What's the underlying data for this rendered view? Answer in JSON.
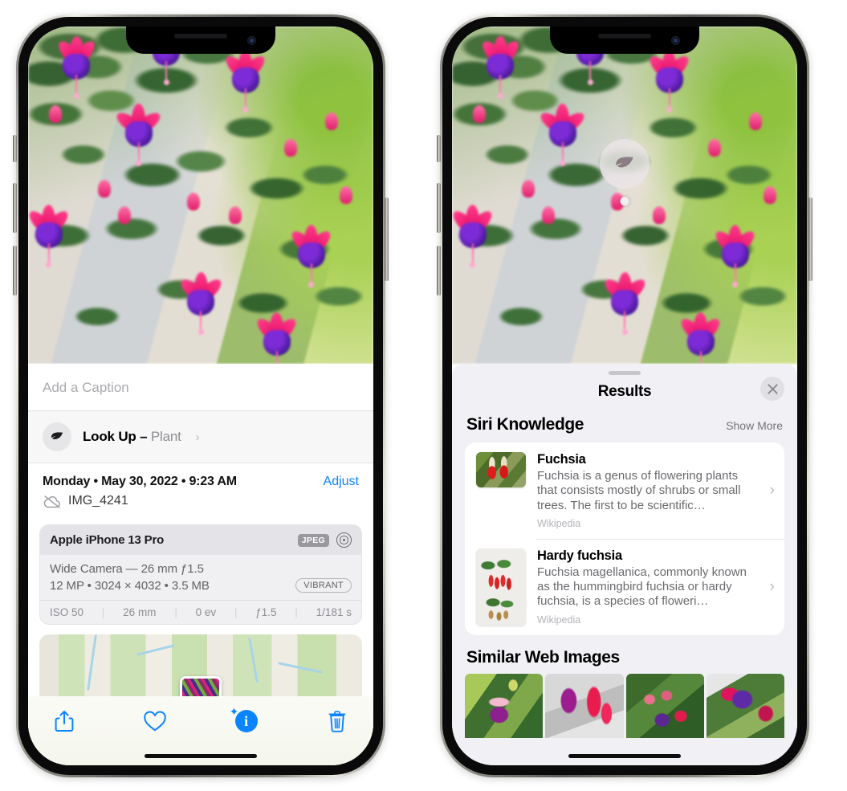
{
  "left_phone": {
    "caption_placeholder": "Add a Caption",
    "lookup": {
      "label": "Look Up – ",
      "subject": "Plant",
      "chevron": "›",
      "icon": "leaf-icon"
    },
    "date": "Monday • May 30, 2022 • 9:23 AM",
    "adjust_label": "Adjust",
    "filename": "IMG_4241",
    "cloud_icon": "cloud-off-icon",
    "camera": {
      "device": "Apple iPhone 13 Pro",
      "format_chip": "JPEG",
      "aperture_icon": "aperture-icon",
      "lens_line": "Wide Camera — 26 mm ƒ1.5",
      "spec_line": "12 MP • 3024 × 4032 • 3.5 MB",
      "style_chip": "VIBRANT",
      "exif": [
        "ISO 50",
        "26 mm",
        "0 ev",
        "ƒ1.5",
        "1/181 s"
      ]
    },
    "toolbar": {
      "share_label": "share-icon",
      "favorite_label": "heart-icon",
      "info_label": "info-icon",
      "delete_label": "trash-icon"
    }
  },
  "right_phone": {
    "hotspot_icon": "leaf-icon",
    "sheet": {
      "title": "Results",
      "close_label": "✕",
      "siri_section": {
        "title": "Siri Knowledge",
        "show_more": "Show More",
        "items": [
          {
            "name": "Fuchsia",
            "description": "Fuchsia is a genus of flowering plants that consists mostly of shrubs or small trees. The first to be scientific…",
            "source": "Wikipedia",
            "chevron": "›"
          },
          {
            "name": "Hardy fuchsia",
            "description": "Fuchsia magellanica, commonly known as the hummingbird fuchsia or hardy fuchsia, is a species of floweri…",
            "source": "Wikipedia",
            "chevron": "›"
          }
        ]
      },
      "web_section": {
        "title": "Similar Web Images",
        "images": [
          "fuchsia-web-image-1",
          "fuchsia-web-image-2",
          "fuchsia-web-image-3",
          "fuchsia-web-image-4"
        ]
      }
    }
  },
  "colors": {
    "accent_blue": "#0a84ff",
    "sheet_bg": "#f1f1f5",
    "card_bg": "#ffffff",
    "muted_text": "#8e8e93"
  }
}
